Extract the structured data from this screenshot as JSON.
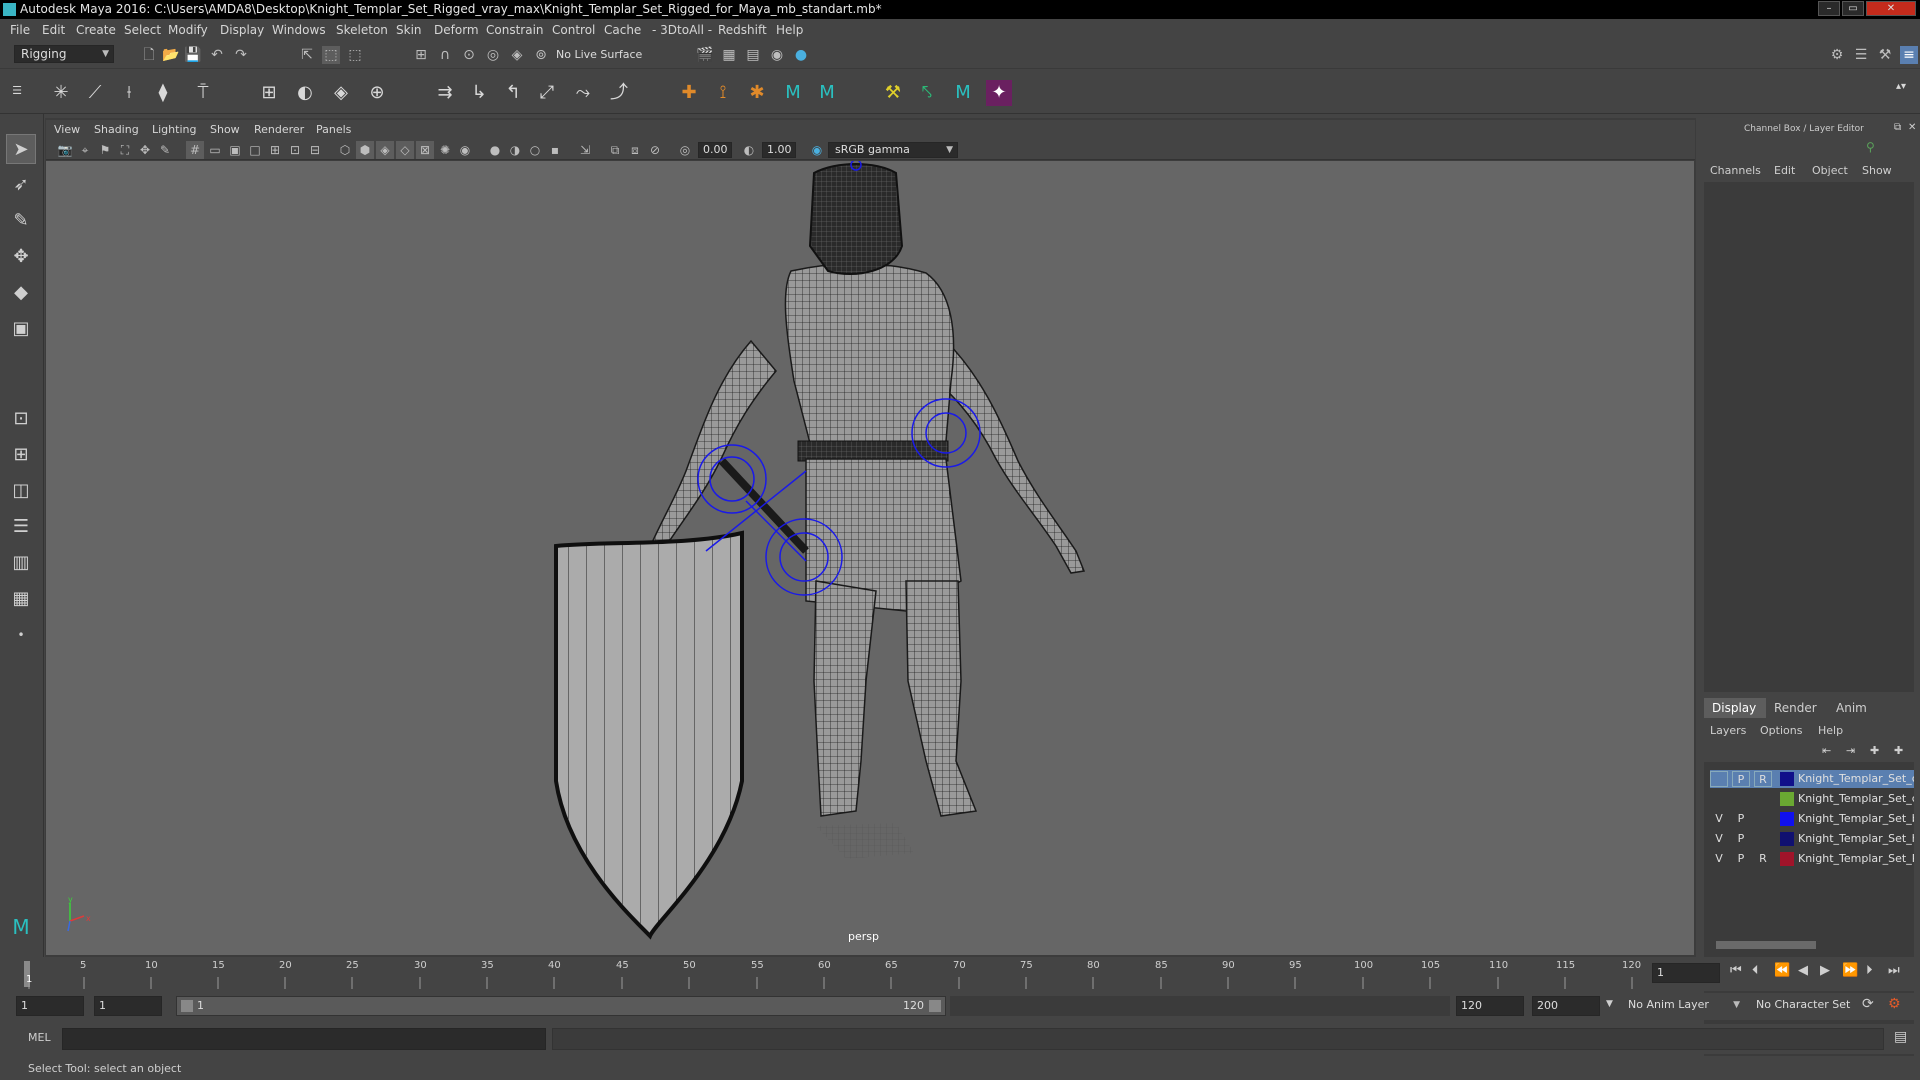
{
  "window": {
    "title": "Autodesk Maya 2016: C:\\Users\\AMDA8\\Desktop\\Knight_Templar_Set_Rigged_vray_max\\Knight_Templar_Set_Rigged_for_Maya_mb_standart.mb*",
    "minimize": "–",
    "maximize": "▭",
    "close": "✕"
  },
  "menubar": [
    "File",
    "Edit",
    "Create",
    "Select",
    "Modify",
    "Display",
    "Windows",
    "Skeleton",
    "Skin",
    "Deform",
    "Constrain",
    "Control",
    "Cache",
    "- 3DtoAll -",
    "Redshift",
    "Help"
  ],
  "statusline": {
    "menuset": "Rigging",
    "live_surface": "No Live Surface"
  },
  "panel_menu": [
    "View",
    "Shading",
    "Lighting",
    "Show",
    "Renderer",
    "Panels"
  ],
  "panel_toolbar": {
    "field1": "0.00",
    "field2": "1.00",
    "color_space": "sRGB gamma"
  },
  "viewport": {
    "camera_label": "persp",
    "axis_x": "x",
    "axis_y": "y"
  },
  "channel_box": {
    "title": "Channel Box / Layer Editor",
    "menus": [
      "Channels",
      "Edit",
      "Object",
      "Show"
    ]
  },
  "layer_editor": {
    "tabs": [
      "Display",
      "Render",
      "Anim"
    ],
    "menus": [
      "Layers",
      "Options",
      "Help"
    ],
    "layers": [
      {
        "v": "",
        "p": "P",
        "r": "R",
        "color": "#10108a",
        "name": "Knight_Templar_Set_co",
        "selected": true
      },
      {
        "v": "",
        "p": "",
        "r": "",
        "color": "#6aa832",
        "name": "Knight_Templar_Set_co",
        "selected": false
      },
      {
        "v": "V",
        "p": "P",
        "r": "",
        "color": "#1010ee",
        "name": "Knight_Templar_Set_bo",
        "selected": false
      },
      {
        "v": "V",
        "p": "P",
        "r": "",
        "color": "#101070",
        "name": "Knight_Templar_Set_he",
        "selected": false
      },
      {
        "v": "V",
        "p": "P",
        "r": "R",
        "color": "#a0142a",
        "name": "Knight_Templar_Set_Ri",
        "selected": false
      }
    ]
  },
  "timeline": {
    "ticks": [
      "1",
      "5",
      "10",
      "15",
      "20",
      "25",
      "30",
      "35",
      "40",
      "45",
      "50",
      "55",
      "60",
      "65",
      "70",
      "75",
      "80",
      "85",
      "90",
      "95",
      "100",
      "105",
      "110",
      "115",
      "120"
    ],
    "current_frame": "1"
  },
  "range": {
    "start": "1",
    "anim_start": "1",
    "range_start_label": "1",
    "range_end_label": "120",
    "end": "120",
    "anim_end": "200",
    "anim_layer": "No Anim Layer",
    "character_set": "No Character Set"
  },
  "command_line": {
    "label": "MEL"
  },
  "help_line": {
    "text": "Select Tool: select an object"
  },
  "colors": {
    "selected_layer": "#5a7fb0",
    "rig_blue": "#1a1ae8"
  }
}
